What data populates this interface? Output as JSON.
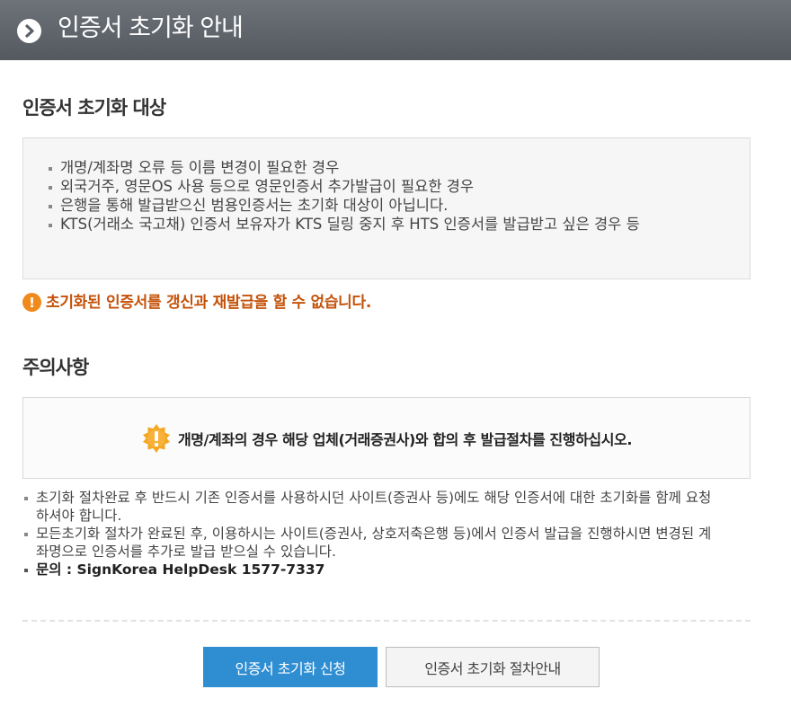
{
  "header": {
    "title": "인증서 초기화 안내",
    "icon": "chevron-right-circle-icon"
  },
  "target_section": {
    "title": "인증서 초기화 대상",
    "items": [
      "개명/계좌명 오류 등 이름 변경이 필요한 경우",
      "외국거주, 영문OS 사용 등으로 영문인증서 추가발급이 필요한 경우",
      "은행을 통해 발급받으신 범용인증서는 초기화 대상이 아닙니다.",
      "KTS(거래소 국고채) 인증서 보유자가 KTS 딜링 중지 후 HTS 인증서를 발급받고 싶은 경우 등"
    ]
  },
  "warning": {
    "icon": "exclamation-circle-icon",
    "text": "초기화된 인증서를 갱신과 재발급을 할 수 없습니다."
  },
  "caution_section": {
    "title": "주의사항",
    "notice_icon": "exclamation-burst-icon",
    "notice_text": "개명/계좌의 경우 해당 업체(거래증권사)와 합의 후 발급절차를 진행하십시오.",
    "notes": [
      "초기화 절차완료 후 반드시 기존 인증서를 사용하시던 사이트(증권사 등)에도 해당 인증서에 대한 초기화를 함께 요청하셔야 합니다.",
      "모든초기화 절차가 완료된 후, 이용하시는 사이트(증권사, 상호저축은행 등)에서 인증서 발급을 진행하시면 변경된 계좌명으로 인증서를 추가로 발급 받으실 수 있습니다."
    ],
    "contact": "문의 : SignKorea HelpDesk 1577-7337"
  },
  "buttons": {
    "apply": "인증서 초기화 신청",
    "guide": "인증서 초기화 절차안내"
  },
  "colors": {
    "header_bg": "#5f646a",
    "warning_text": "#c4520a",
    "primary_button": "#2f8ed2"
  }
}
